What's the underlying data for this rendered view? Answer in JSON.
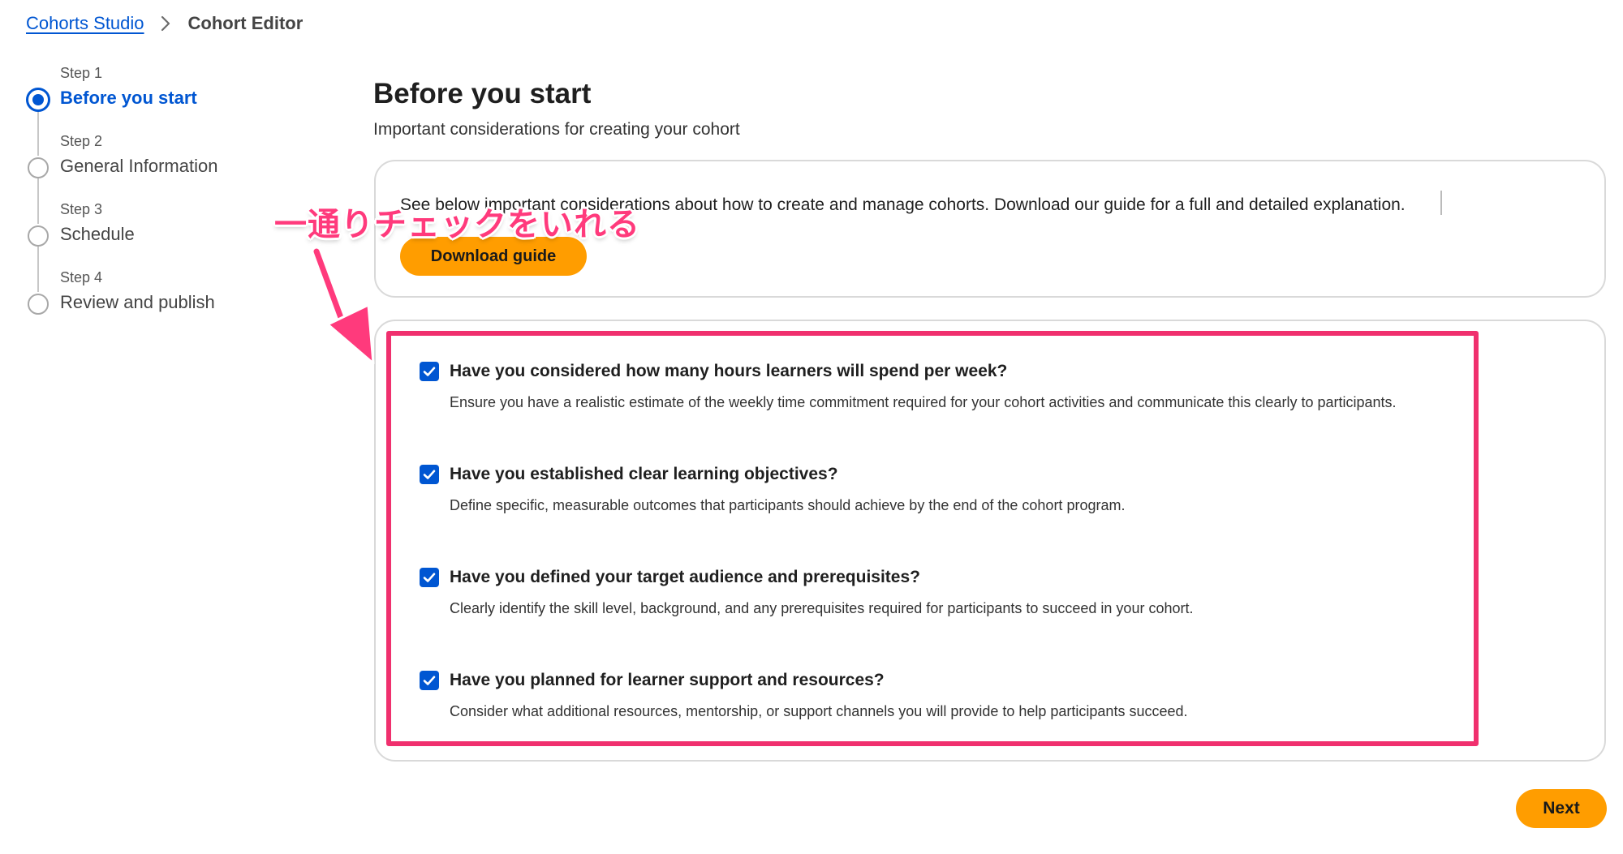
{
  "breadcrumb": {
    "studio_link": "Cohorts Studio",
    "current": "Cohort Editor"
  },
  "stepper": {
    "steps": [
      {
        "number": "Step 1",
        "label": "Before you start",
        "active": true
      },
      {
        "number": "Step 2",
        "label": "General Information",
        "active": false
      },
      {
        "number": "Step 3",
        "label": "Schedule",
        "active": false
      },
      {
        "number": "Step 4",
        "label": "Review and publish",
        "active": false
      }
    ]
  },
  "header": {
    "title": "Before you start",
    "subtitle": "Important considerations for creating your cohort"
  },
  "guide": {
    "text": "See below important considerations about how to create and manage cohorts. Download our guide for a full and detailed explanation.",
    "download_label": "Download guide"
  },
  "checklist": {
    "items": [
      {
        "title": "Have you considered how many hours learners will spend per week?",
        "description": "Ensure you have a realistic estimate of the weekly time commitment required for your cohort activities and communicate this clearly to participants.",
        "checked": true
      },
      {
        "title": "Have you established clear learning objectives?",
        "description": "Define specific, measurable outcomes that participants should achieve by the end of the cohort program.",
        "checked": true
      },
      {
        "title": "Have you defined your target audience and prerequisites?",
        "description": "Clearly identify the skill level, background, and any prerequisites required for participants to succeed in your cohort.",
        "checked": true
      },
      {
        "title": "Have you planned for learner support and resources?",
        "description": "Consider what additional resources, mentorship, or support channels you will provide to help participants succeed.",
        "checked": true
      }
    ]
  },
  "annotation": {
    "text": "一通りチェックをいれる",
    "color": "#f0306e"
  },
  "footer": {
    "next_label": "Next"
  },
  "colors": {
    "accent": "#0056d2",
    "button": "#ff9d00"
  }
}
